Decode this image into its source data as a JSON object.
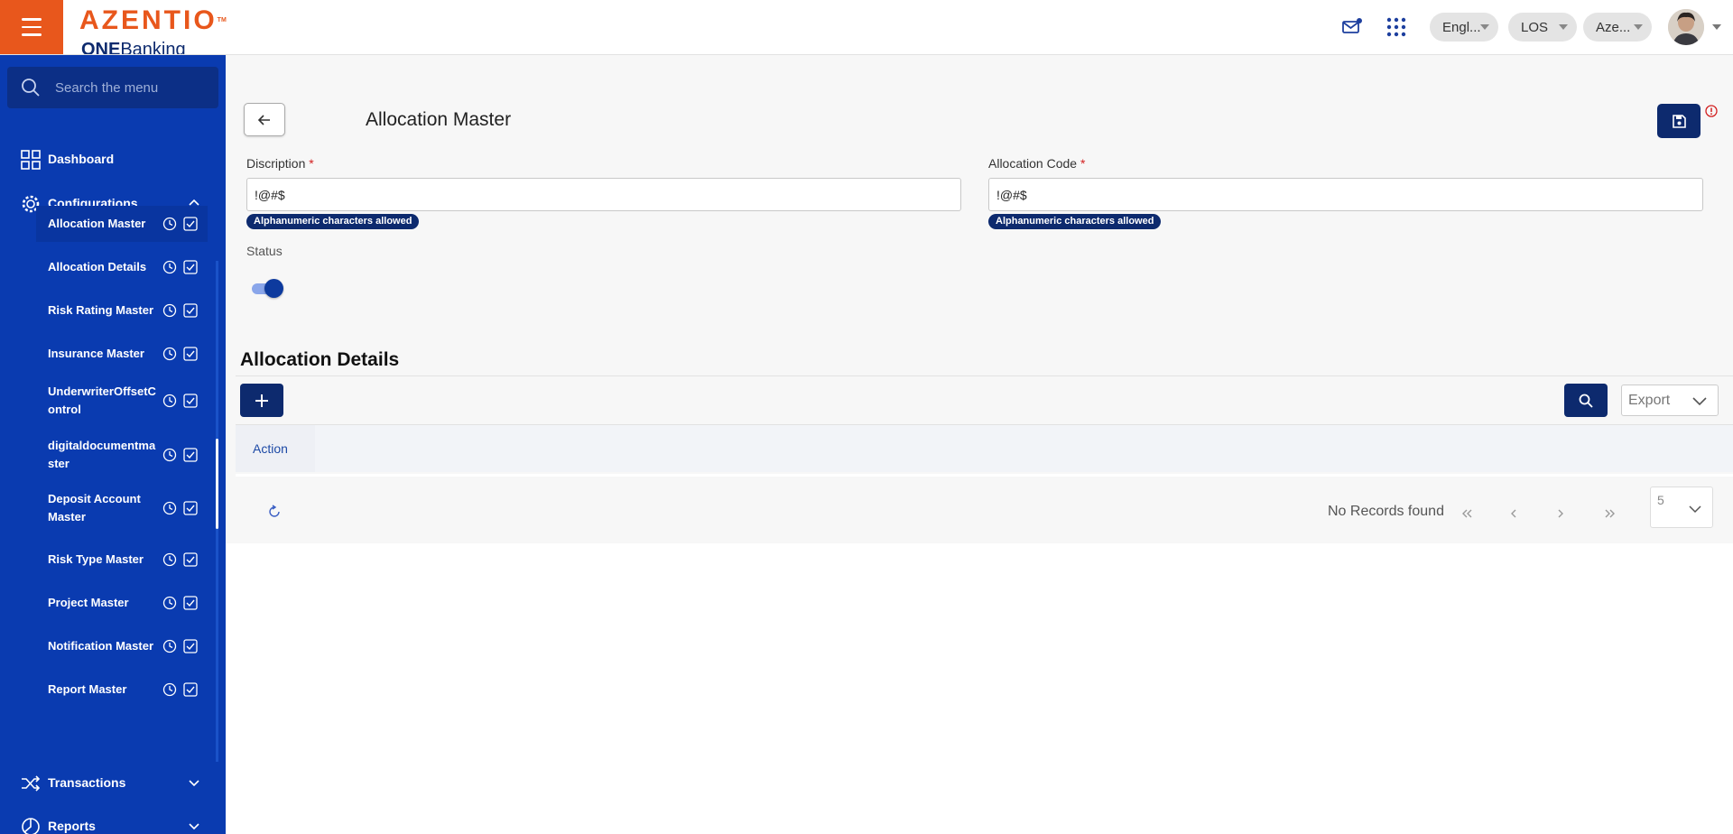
{
  "header": {
    "logo_main": "AZENTIO",
    "logo_tm": "TM",
    "logo_sub_bold": "ONE",
    "logo_sub_rest": "Banking",
    "language": "Engl...",
    "module": "LOS",
    "entity": "Aze..."
  },
  "sidebar": {
    "search_placeholder": "Search the menu",
    "dashboard": "Dashboard",
    "configurations": "Configurations",
    "transactions": "Transactions",
    "reports": "Reports",
    "config_items": [
      {
        "label": "Allocation Master"
      },
      {
        "label": "Allocation Details"
      },
      {
        "label": "Risk Rating Master"
      },
      {
        "label": "Insurance Master"
      },
      {
        "label": "UnderwriterOffsetC ontrol"
      },
      {
        "label": "digitaldocumentma ster"
      },
      {
        "label": "Deposit Account Master"
      },
      {
        "label": "Risk Type Master"
      },
      {
        "label": "Project Master"
      },
      {
        "label": "Notification Master"
      },
      {
        "label": "Report Master"
      }
    ]
  },
  "form": {
    "title": "Allocation Master",
    "description_label": "Discription",
    "description_value": "!@#$",
    "code_label": "Allocation Code",
    "code_value": "!@#$",
    "required_mark": "*",
    "hint": "Alphanumeric characters allowed",
    "status_label": "Status",
    "status_on": true
  },
  "details": {
    "title": "Allocation Details",
    "export_label": "Export",
    "column_action": "Action",
    "no_records": "No Records found",
    "page_size": "5"
  },
  "colors": {
    "brand_orange": "#e8571c",
    "sidebar_blue": "#0a3bb0",
    "primary_navy": "#0d2a6e"
  }
}
